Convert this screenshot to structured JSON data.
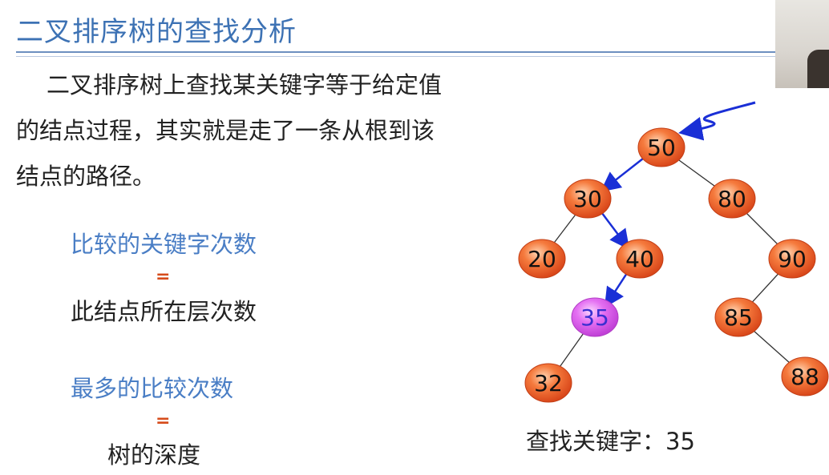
{
  "title": "二叉排序树的查找分析",
  "paragraph": {
    "line1": "二叉排序树上查找某关键字等于给定值",
    "line2": "的结点过程，其实就是走了一条从根到该",
    "line3": "结点的路径。"
  },
  "relations": [
    {
      "top": "比较的关键字次数",
      "equals": "=",
      "bottom": "此结点所在层次数"
    },
    {
      "top": "最多的比较次数",
      "equals": "=",
      "bottom": "树的深度"
    }
  ],
  "search_caption": "查找关键字：35",
  "tree": {
    "nodes": [
      {
        "id": "n50",
        "label": "50"
      },
      {
        "id": "n30",
        "label": "30"
      },
      {
        "id": "n80",
        "label": "80"
      },
      {
        "id": "n20",
        "label": "20"
      },
      {
        "id": "n40",
        "label": "40"
      },
      {
        "id": "n90",
        "label": "90"
      },
      {
        "id": "n35",
        "label": "35",
        "highlight": true
      },
      {
        "id": "n85",
        "label": "85"
      },
      {
        "id": "n32",
        "label": "32"
      },
      {
        "id": "n88",
        "label": "88"
      }
    ],
    "edges": [
      [
        "n50",
        "n30"
      ],
      [
        "n50",
        "n80"
      ],
      [
        "n30",
        "n20"
      ],
      [
        "n30",
        "n40"
      ],
      [
        "n40",
        "n35"
      ],
      [
        "n80",
        "n90"
      ],
      [
        "n90",
        "n85"
      ],
      [
        "n35",
        "n32"
      ],
      [
        "n85",
        "n88"
      ]
    ],
    "search_path": [
      [
        "n50",
        "n30"
      ],
      [
        "n30",
        "n40"
      ],
      [
        "n40",
        "n35"
      ]
    ]
  },
  "colors": {
    "title": "#3d72b4",
    "node_fill": "#f2622b",
    "highlight_fill": "#e066f0",
    "path_arrow": "#1a2fd6",
    "edge": "#333333",
    "equals_sign": "#d64b1a"
  }
}
